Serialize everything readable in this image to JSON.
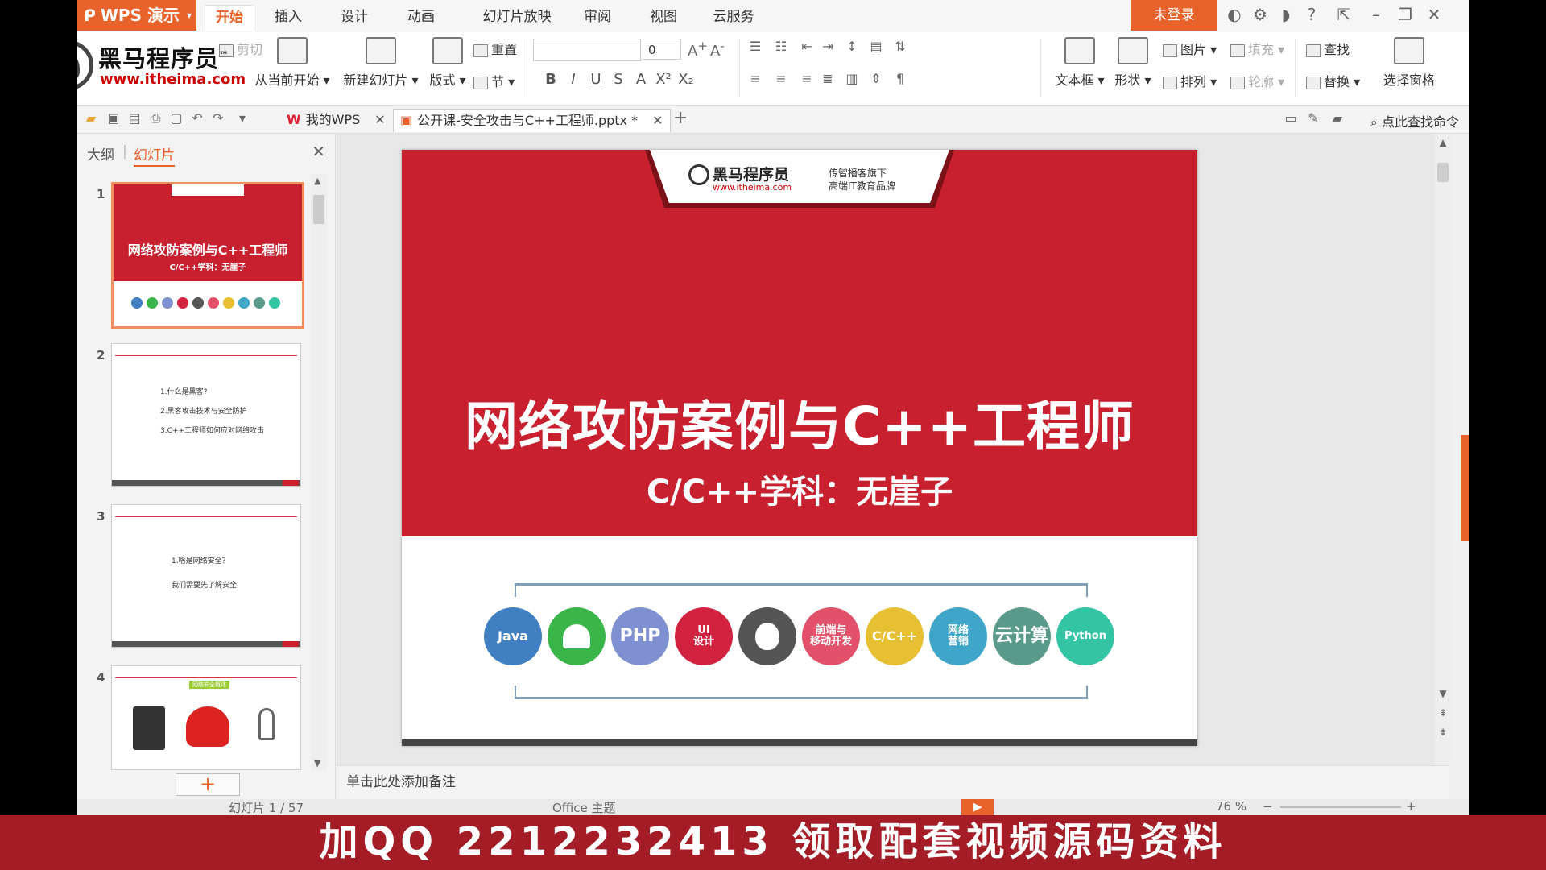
{
  "app": {
    "name": "WPS 演示",
    "login": "未登录"
  },
  "menu": [
    "开始",
    "插入",
    "设计",
    "动画",
    "幻灯片放映",
    "审阅",
    "视图",
    "云服务"
  ],
  "ribbon": {
    "from_current": "从当前开始",
    "new_slide": "新建幻灯片",
    "layout": "版式",
    "reset": "重置",
    "section": "节",
    "font_size": "0",
    "cut": "剪切",
    "text_box": "文本框",
    "shape": "形状",
    "picture": "图片",
    "arrange": "排列",
    "fill": "填充",
    "outline": "轮廓",
    "find": "查找",
    "replace": "替换",
    "select_pane": "选择窗格",
    "fmt": [
      "B",
      "I",
      "U",
      "S",
      "A",
      "X²",
      "X₂"
    ]
  },
  "watermark": {
    "name": "黑马程序员",
    "tm": "™",
    "url": "www.itheima.com"
  },
  "tabs": {
    "my_wps": "我的WPS",
    "doc": "公开课-安全攻击与C++工程师.pptx *"
  },
  "search_cmd": "点此查找命令",
  "left_panel": {
    "tab_outline": "大纲",
    "tab_slides": "幻灯片",
    "thumbs": [
      {
        "num": "1",
        "title": "网络攻防案例与C++工程师",
        "sub": "C/C++学科：无崖子"
      },
      {
        "num": "2",
        "lines": [
          "1.什么是黑客?",
          "2.黑客攻击技术与安全防护",
          "3.C++工程师如何应对网络攻击"
        ]
      },
      {
        "num": "3",
        "lines": [
          "1.啥是网络安全？",
          "我们需要先了解安全"
        ]
      },
      {
        "num": "4",
        "badge": "网络安全概述"
      }
    ],
    "add": "+"
  },
  "slide": {
    "brand": "黑马程序员",
    "brand_url": "www.itheima.com",
    "brand_tag1": "传智播客旗下",
    "brand_tag2": "高端IT教育品牌",
    "title": "网络攻防案例与C++工程师",
    "subtitle": "C/C++学科：无崖子",
    "circles": [
      {
        "label": "Java",
        "color": "#3f7fc2"
      },
      {
        "label": "",
        "color": "#3ab54a"
      },
      {
        "label": "PHP",
        "color": "#7e90d0"
      },
      {
        "label": "UI\n设计",
        "color": "#d3223f"
      },
      {
        "label": "",
        "color": "#555555"
      },
      {
        "label": "前端与\n移动开发",
        "color": "#e2506a"
      },
      {
        "label": "C/C++",
        "color": "#e6c032"
      },
      {
        "label": "网络\n营销",
        "color": "#3fa6c9"
      },
      {
        "label": "云计算",
        "color": "#5a9a8a"
      },
      {
        "label": "Python",
        "color": "#33c4a4"
      }
    ]
  },
  "notes_placeholder": "单击此处添加备注",
  "status": {
    "slide": "幻灯片 1 / 57",
    "theme": "Office 主题",
    "zoom": "76 %"
  },
  "banner": "加QQ 2212232413  领取配套视频源码资料"
}
